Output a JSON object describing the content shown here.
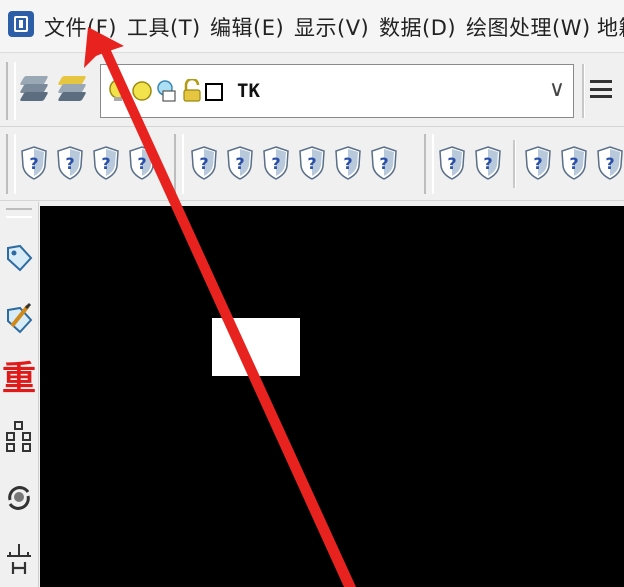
{
  "menu": {
    "items": [
      {
        "label": "文件(F)"
      },
      {
        "label": "工具(T)"
      },
      {
        "label": "编辑(E)"
      },
      {
        "label": "显示(V)"
      },
      {
        "label": "数据(D)"
      },
      {
        "label": "绘图处理(W)"
      },
      {
        "label": "地籍"
      }
    ]
  },
  "layer_toolbar": {
    "layer_combo_value": "TK",
    "dropdown_glyph": "∨"
  },
  "left_panel": {
    "overlay_char": "重"
  },
  "colors": {
    "canvas_bg": "#000000",
    "annotation_arrow": "#e8231f",
    "overlay_char_color": "#e01919"
  },
  "icons": [
    "app-logo-icon",
    "layer-stack-icon",
    "layer-manager-icon",
    "help-question-icon",
    "menu-lines-icon"
  ]
}
